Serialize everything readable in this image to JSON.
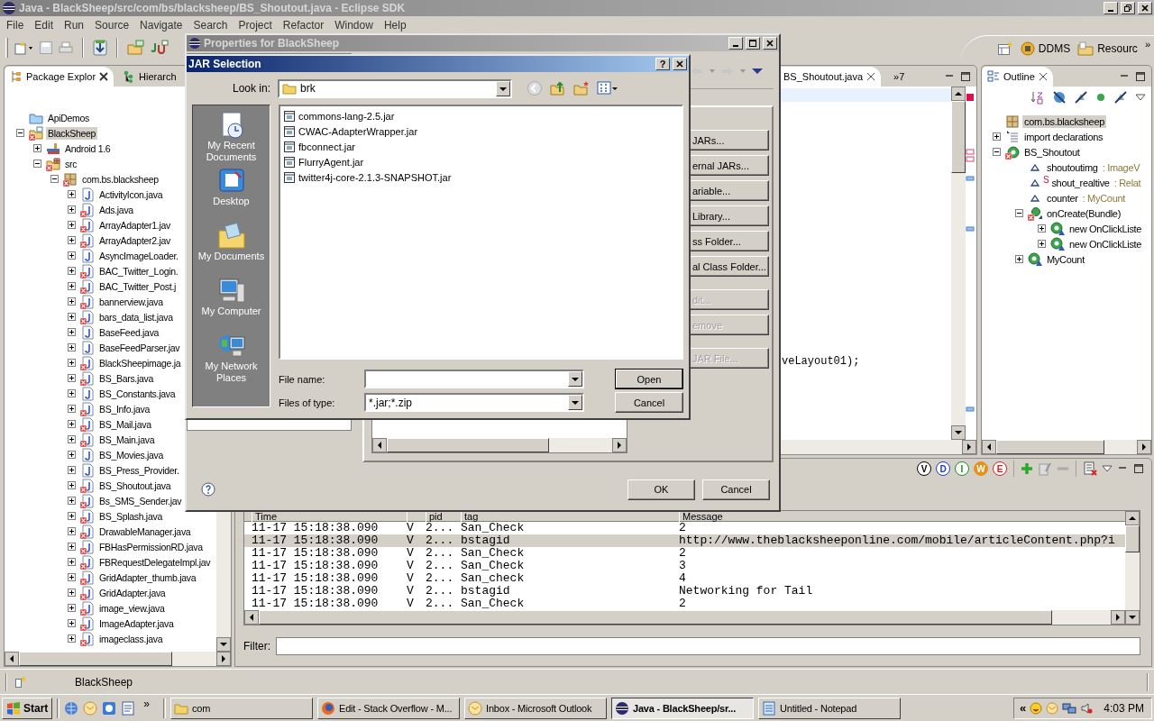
{
  "window": {
    "title": "Java - BlackSheep/src/com/bs/blacksheep/BS_Shoutout.java - Eclipse SDK"
  },
  "menu": [
    "File",
    "Edit",
    "Run",
    "Source",
    "Navigate",
    "Search",
    "Project",
    "Refactor",
    "Window",
    "Help"
  ],
  "perspectives": [
    {
      "label": "DDMS",
      "kind": "ddms"
    },
    {
      "label": "Resourc",
      "kind": "resource"
    }
  ],
  "perspective_more": "»",
  "package_explorer": {
    "tabs": [
      {
        "label": "Package Explor",
        "kind": "packages",
        "selected": true
      },
      {
        "label": "Hierarch",
        "kind": "hierarchy",
        "selected": false
      }
    ],
    "tree": [
      {
        "label": "ApiDemos",
        "kind": "project",
        "error": false,
        "selected": false
      },
      {
        "label": "BlackSheep",
        "kind": "android_project",
        "error": true,
        "expanded": true,
        "selected": true,
        "children": [
          {
            "label": "Android 1.6",
            "kind": "library",
            "error": false,
            "expanded": false,
            "selected": false
          },
          {
            "label": "src",
            "kind": "source_folder",
            "error": true,
            "expanded": true,
            "selected": false,
            "children": [
              {
                "label": "com.bs.blacksheep",
                "kind": "package",
                "error": true,
                "expanded": true,
                "selected": false,
                "children": [
                  {
                    "label": "ActivityIcon.java",
                    "kind": "java",
                    "error": false,
                    "expanded": false,
                    "selected": false
                  },
                  {
                    "label": "Ads.java",
                    "kind": "java",
                    "error": true,
                    "expanded": false,
                    "selected": false
                  },
                  {
                    "label": "ArrayAdapter1.jav",
                    "kind": "java",
                    "error": true,
                    "expanded": false,
                    "selected": false
                  },
                  {
                    "label": "ArrayAdapter2.jav",
                    "kind": "java",
                    "error": true,
                    "expanded": false,
                    "selected": false
                  },
                  {
                    "label": "AsyncImageLoader.",
                    "kind": "java",
                    "error": false,
                    "expanded": false,
                    "selected": false
                  },
                  {
                    "label": "BAC_Twitter_Login.",
                    "kind": "java",
                    "error": true,
                    "expanded": false,
                    "selected": false
                  },
                  {
                    "label": "BAC_Twitter_Post.j",
                    "kind": "java",
                    "error": true,
                    "expanded": false,
                    "selected": false
                  },
                  {
                    "label": "bannerview.java",
                    "kind": "java",
                    "error": true,
                    "expanded": false,
                    "selected": false
                  },
                  {
                    "label": "bars_data_list.java",
                    "kind": "java",
                    "error": true,
                    "expanded": false,
                    "selected": false
                  },
                  {
                    "label": "BaseFeed.java",
                    "kind": "java",
                    "error": false,
                    "expanded": false,
                    "selected": false
                  },
                  {
                    "label": "BaseFeedParser.jav",
                    "kind": "java",
                    "error": false,
                    "expanded": false,
                    "selected": false
                  },
                  {
                    "label": "BlackSheepimage.ja",
                    "kind": "java",
                    "error": true,
                    "expanded": false,
                    "selected": false
                  },
                  {
                    "label": "BS_Bars.java",
                    "kind": "java",
                    "error": true,
                    "expanded": false,
                    "selected": false
                  },
                  {
                    "label": "BS_Constants.java",
                    "kind": "java",
                    "error": false,
                    "expanded": false,
                    "selected": false
                  },
                  {
                    "label": "BS_Info.java",
                    "kind": "java",
                    "error": true,
                    "expanded": false,
                    "selected": false
                  },
                  {
                    "label": "BS_Mail.java",
                    "kind": "java",
                    "error": true,
                    "expanded": false,
                    "selected": false
                  },
                  {
                    "label": "BS_Main.java",
                    "kind": "java",
                    "error": true,
                    "expanded": false,
                    "selected": false
                  },
                  {
                    "label": "BS_Movies.java",
                    "kind": "java",
                    "error": false,
                    "expanded": false,
                    "selected": false
                  },
                  {
                    "label": "BS_Press_Provider.",
                    "kind": "java",
                    "error": false,
                    "expanded": false,
                    "selected": false
                  },
                  {
                    "label": "BS_Shoutout.java",
                    "kind": "java",
                    "error": true,
                    "expanded": false,
                    "selected": false
                  },
                  {
                    "label": "Bs_SMS_Sender.jav",
                    "kind": "java",
                    "error": true,
                    "expanded": false,
                    "selected": false
                  },
                  {
                    "label": "BS_Splash.java",
                    "kind": "java",
                    "error": true,
                    "expanded": false,
                    "selected": false
                  },
                  {
                    "label": "DrawableManager.java",
                    "kind": "java",
                    "error": true,
                    "expanded": false,
                    "selected": false
                  },
                  {
                    "label": "FBHasPermissionRD.java",
                    "kind": "java",
                    "error": true,
                    "expanded": false,
                    "selected": false
                  },
                  {
                    "label": "FBRequestDelegateImpl.jav",
                    "kind": "java",
                    "error": true,
                    "expanded": false,
                    "selected": false
                  },
                  {
                    "label": "GridAdapter_thumb.java",
                    "kind": "java",
                    "error": true,
                    "expanded": false,
                    "selected": false
                  },
                  {
                    "label": "GridAdapter.java",
                    "kind": "java",
                    "error": true,
                    "expanded": false,
                    "selected": false
                  },
                  {
                    "label": "image_view.java",
                    "kind": "java",
                    "error": true,
                    "expanded": false,
                    "selected": false
                  },
                  {
                    "label": "ImageAdapter.java",
                    "kind": "java",
                    "error": true,
                    "expanded": false,
                    "selected": false
                  },
                  {
                    "label": "imageclass.java",
                    "kind": "java",
                    "error": true,
                    "expanded": false,
                    "selected": false
                  }
                ]
              }
            ]
          }
        ]
      }
    ]
  },
  "editor": {
    "tabs": [
      {
        "label": "BS_Shoutout.java",
        "selected": true
      }
    ],
    "overflow": "»7",
    "code_line": "veLayout01);"
  },
  "outline": {
    "title": "Outline",
    "tree": [
      {
        "label": "com.bs.blacksheep",
        "kind": "package",
        "selected": true
      },
      {
        "label": "import declarations",
        "kind": "imports",
        "expanded": false,
        "selected": false
      },
      {
        "label": "BS_Shoutout",
        "kind": "class",
        "error": true,
        "expanded": true,
        "selected": false,
        "children": [
          {
            "label": "shoutoutimg",
            "type": ": ImageV",
            "kind": "field",
            "selected": false
          },
          {
            "label": "shout_realtive",
            "modifier": "S",
            "type": ": Relat",
            "kind": "field",
            "selected": false
          },
          {
            "label": "counter",
            "type": ": MyCount",
            "kind": "field",
            "selected": false
          },
          {
            "label": "onCreate(Bundle)",
            "kind": "method",
            "error": true,
            "expanded": true,
            "selected": false,
            "children": [
              {
                "label": "new OnClickListe",
                "kind": "inner_class",
                "expanded": false,
                "selected": false
              },
              {
                "label": "new OnClickListe",
                "kind": "inner_class",
                "expanded": false,
                "selected": false
              }
            ]
          },
          {
            "label": "MyCount",
            "kind": "inner_class",
            "expanded": false,
            "selected": false
          }
        ]
      }
    ]
  },
  "log": {
    "level_filters": [
      {
        "label": "V",
        "color": "#000000",
        "filled": false
      },
      {
        "label": "D",
        "color": "#1c3fc8",
        "filled": false
      },
      {
        "label": "I",
        "color": "#1e8a2a",
        "filled": false
      },
      {
        "label": "W",
        "color": "#e8901a",
        "filled": true
      },
      {
        "label": "E",
        "color": "#d42020",
        "filled": false
      }
    ],
    "columns": [
      "Time",
      "pid",
      "tag",
      "Message"
    ],
    "rows": [
      {
        "time": "11-17 15:18:38.090",
        "level": "V",
        "pid": "2...",
        "tag": "San_Check",
        "message": "2",
        "selected": false
      },
      {
        "time": "11-17 15:18:38.090",
        "level": "V",
        "pid": "2...",
        "tag": "bstagid",
        "message": "http://www.theblacksheeponline.com/mobile/articleContent.php?i",
        "selected": true
      },
      {
        "time": "11-17 15:18:38.090",
        "level": "V",
        "pid": "2...",
        "tag": "San_Check",
        "message": "2",
        "selected": false
      },
      {
        "time": "11-17 15:18:38.090",
        "level": "V",
        "pid": "2...",
        "tag": "San_Check",
        "message": "3",
        "selected": false
      },
      {
        "time": "11-17 15:18:38.090",
        "level": "V",
        "pid": "2...",
        "tag": "San_check",
        "message": "4",
        "selected": false
      },
      {
        "time": "11-17 15:18:38.090",
        "level": "V",
        "pid": "2...",
        "tag": "bstagid",
        "message": "Networking for Tail",
        "selected": false
      },
      {
        "time": "11-17 15:18:38.090",
        "level": "V",
        "pid": "2...",
        "tag": "San_Check",
        "message": "2",
        "selected": false
      }
    ],
    "filter_label": "Filter:"
  },
  "status_bar": {
    "text": "BlackSheep"
  },
  "properties_dialog": {
    "title": "Properties for BlackSheep",
    "buttons": [
      {
        "label": "JARs...",
        "disabled": false
      },
      {
        "label": "ernal JARs...",
        "disabled": false
      },
      {
        "label": "ariable...",
        "disabled": false
      },
      {
        "label": "Library...",
        "disabled": false
      },
      {
        "label": "ss Folder...",
        "disabled": false
      },
      {
        "label": "al Class Folder...",
        "disabled": false
      },
      {
        "label": "dit...",
        "disabled": true
      },
      {
        "label": "emove",
        "disabled": true
      },
      {
        "label": "JAR File...",
        "disabled": true
      }
    ],
    "ok": "OK",
    "cancel": "Cancel"
  },
  "jar_dialog": {
    "title": "JAR Selection",
    "help": "?",
    "look_in_label": "Look in:",
    "look_in": "brk",
    "places": [
      {
        "label": "My Recent Documents",
        "kind": "recent"
      },
      {
        "label": "Desktop",
        "kind": "desktop"
      },
      {
        "label": "My Documents",
        "kind": "documents"
      },
      {
        "label": "My Computer",
        "kind": "computer"
      },
      {
        "label": "My Network Places",
        "kind": "network"
      }
    ],
    "files": [
      "commons-lang-2.5.jar",
      "CWAC-AdapterWrapper.jar",
      "fbconnect.jar",
      "FlurryAgent.jar",
      "twitter4j-core-2.1.3-SNAPSHOT.jar"
    ],
    "file_name_label": "File name:",
    "file_type_label": "Files of type:",
    "file_type": "*.jar;*.zip",
    "open": "Open",
    "cancel": "Cancel"
  },
  "taskbar": {
    "start": "Start",
    "more": "»",
    "tasks": [
      {
        "label": "com",
        "kind": "folder",
        "selected": false
      },
      {
        "label": "Edit - Stack Overflow - M...",
        "kind": "browser",
        "selected": false
      },
      {
        "label": "Inbox - Microsoft Outlook",
        "kind": "mail",
        "selected": false
      },
      {
        "label": "Java - BlackSheep/sr...",
        "kind": "eclipse",
        "selected": true
      },
      {
        "label": "Untitled - Notepad",
        "kind": "notepad",
        "selected": false
      }
    ],
    "tray_more": "«",
    "clock": "4:03 PM"
  }
}
